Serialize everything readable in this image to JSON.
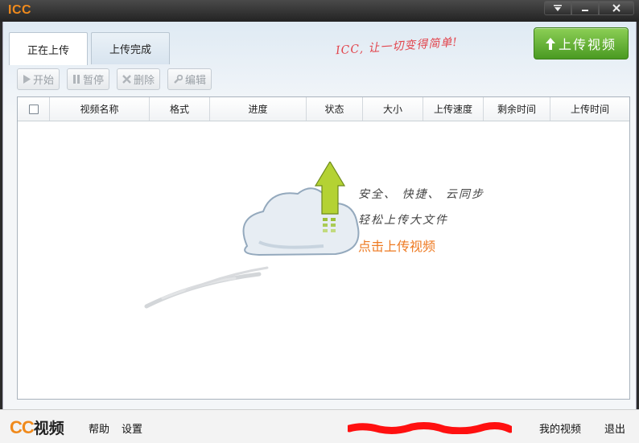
{
  "window": {
    "title": "ICC",
    "controls": [
      "menu-dropdown",
      "minimize",
      "close"
    ]
  },
  "tabs": [
    {
      "label": "正在上传",
      "active": true
    },
    {
      "label": "上传完成",
      "active": false
    }
  ],
  "tagline": "ICC, 让一切变得简单!",
  "upload_button": {
    "label": "上传视频",
    "icon": "up-arrow-icon"
  },
  "toolbar": {
    "start": "开始",
    "pause": "暂停",
    "delete": "删除",
    "edit": "编辑"
  },
  "table": {
    "columns": [
      "视频名称",
      "格式",
      "进度",
      "状态",
      "大小",
      "上传速度",
      "剩余时间",
      "上传时间"
    ],
    "rows": []
  },
  "empty_state": {
    "line1": "安全、 快捷、 云同步",
    "line2": "轻松上传大文件",
    "action": "点击上传视频"
  },
  "footer": {
    "brand_cc": "CC",
    "brand_video": "视频",
    "help": "帮助",
    "settings": "设置",
    "my_videos": "我的视频",
    "logout": "退出"
  },
  "colors": {
    "accent": "#f08a1c",
    "upload_green": "#5aab2e",
    "tagline_red": "#e2434b",
    "action_orange": "#ee7a22",
    "redaction": "#ff1010"
  }
}
